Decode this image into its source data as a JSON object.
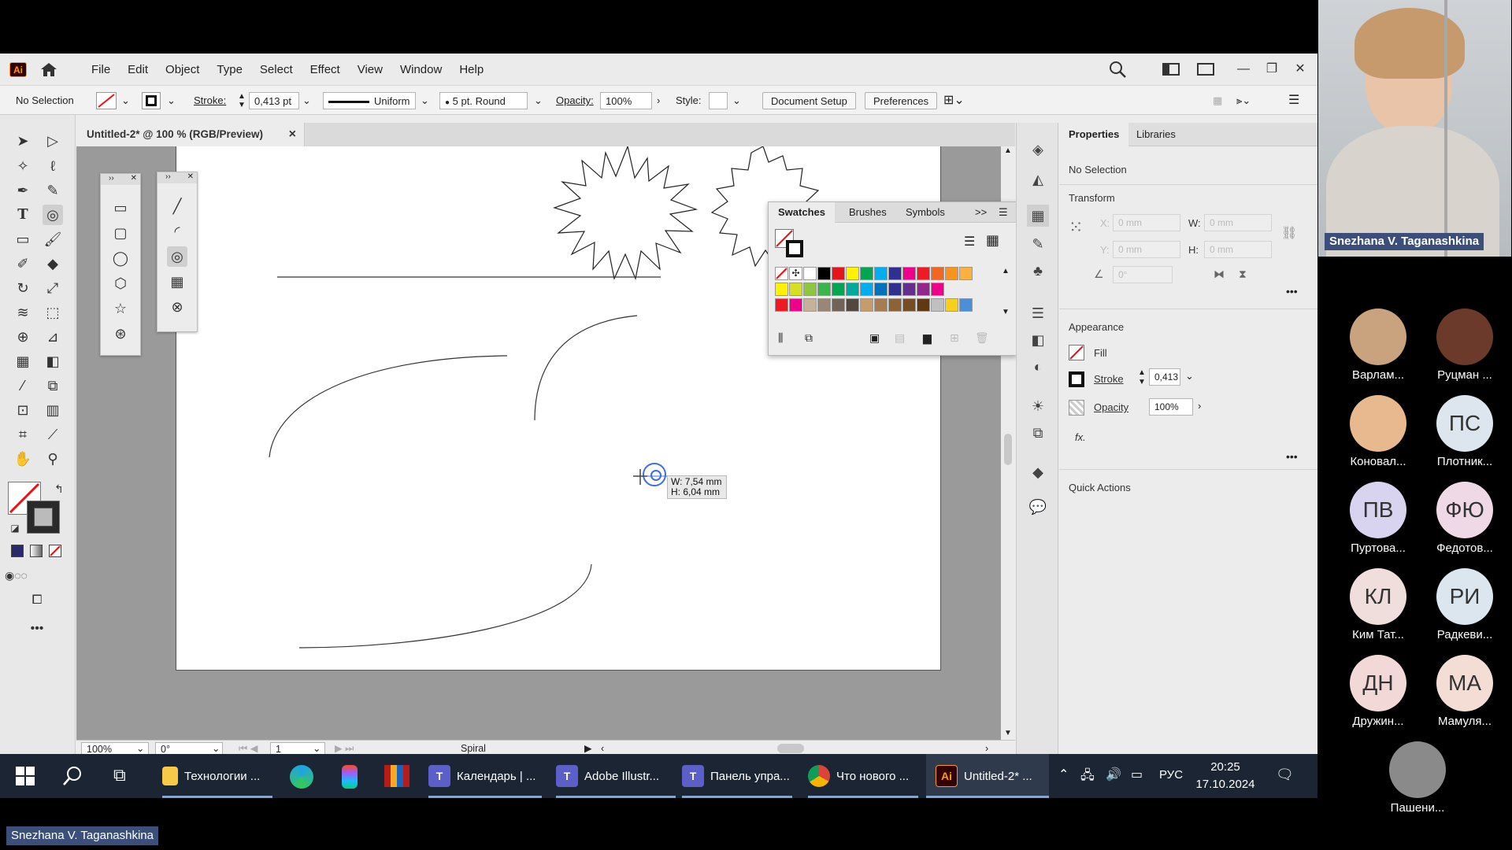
{
  "app": {
    "logo": "Ai",
    "menus": [
      "File",
      "Edit",
      "Object",
      "Type",
      "Select",
      "Effect",
      "View",
      "Window",
      "Help"
    ]
  },
  "control_bar": {
    "selection_label": "No Selection",
    "stroke_label": "Stroke:",
    "stroke_value": "0,413 pt",
    "profile_label": "Uniform",
    "brush_label": "5 pt. Round",
    "opacity_label": "Opacity:",
    "opacity_value": "100%",
    "style_label": "Style:",
    "document_setup": "Document Setup",
    "preferences": "Preferences"
  },
  "document_tab": {
    "title": "Untitled-2* @ 100 % (RGB/Preview)",
    "close": "×"
  },
  "tooltip": {
    "w": "W: 7,54 mm",
    "h": "H: 6,04 mm"
  },
  "swatches_panel": {
    "tabs": [
      "Swatches",
      "Brushes",
      "Symbols"
    ],
    "more": ">>"
  },
  "swatch_colors": [
    [
      "none",
      "reg",
      "#ffffff",
      "#000000",
      "#e8141b",
      "#fff200",
      "#00a651",
      "#00aeef",
      "#2e3192",
      "#ec008c",
      "#ed1c24",
      "#f26522",
      "#f7941d",
      "#fbb040"
    ],
    [
      "#fff200",
      "#d7df23",
      "#8dc63f",
      "#39b54a",
      "#00a651",
      "#00a99d",
      "#00aeef",
      "#0072bc",
      "#2e3192",
      "#662d91",
      "#92278f",
      "#ec008c"
    ],
    [
      "#ed1c24",
      "#ec008c",
      "#c7b299",
      "#998675",
      "#736357",
      "#534741",
      "#c69c6d",
      "#a67c52",
      "#8c6239",
      "#754c24",
      "#603913",
      "#c0c0c0",
      "#f7d117",
      "#4a90d9"
    ]
  ],
  "properties": {
    "tabs": [
      "Properties",
      "Libraries"
    ],
    "selection": "No Selection",
    "transform_label": "Transform",
    "x_label": "X:",
    "y_label": "Y:",
    "w_label": "W:",
    "h_label": "H:",
    "x_value": "0 mm",
    "y_value": "0 mm",
    "w_value": "0 mm",
    "h_value": "0 mm",
    "angle_value": "0°",
    "appearance_label": "Appearance",
    "fill_label": "Fill",
    "stroke_label": "Stroke",
    "stroke_value": "0,413",
    "opacity_label": "Opacity",
    "opacity_value": "100%",
    "fx": "fx.",
    "quick_actions": "Quick Actions"
  },
  "statusbar": {
    "zoom": "100%",
    "rotation": "0°",
    "artboard": "1",
    "tool": "Spiral"
  },
  "taskbar": {
    "items": [
      "Технологии ...",
      "Календарь | ...",
      "Adobe Illustr...",
      "Панель упра...",
      "Что нового ...",
      "Untitled-2* ..."
    ],
    "lang": "РУС",
    "time": "20:25",
    "date": "17.10.2024"
  },
  "video": {
    "presenter": "Snezhana V. Taganashkina",
    "bottom_label": "Snezhana V. Taganashkina",
    "participants": [
      {
        "initials": "",
        "name": "Варлам...",
        "color": "#c9a27e"
      },
      {
        "initials": "",
        "name": "Руцман ...",
        "color": "#6b3a2a"
      },
      {
        "initials": "",
        "name": "Коновал...",
        "color": "#e8b98f"
      },
      {
        "initials": "ПС",
        "name": "Плотник...",
        "color": "#dde6ee"
      },
      {
        "initials": "ПВ",
        "name": "Пуртова...",
        "color": "#d8d3ef"
      },
      {
        "initials": "ФЮ",
        "name": "Федотов...",
        "color": "#f0d9e6"
      },
      {
        "initials": "КЛ",
        "name": "Ким Тат...",
        "color": "#f0dedc"
      },
      {
        "initials": "РИ",
        "name": "Радкеви...",
        "color": "#dbe6ef"
      },
      {
        "initials": "ДН",
        "name": "Дружин...",
        "color": "#f3d8d8"
      },
      {
        "initials": "МА",
        "name": "Мамуля...",
        "color": "#f3ddd5"
      },
      {
        "initials": "",
        "name": "Пашени...",
        "color": "#8a8a8a"
      }
    ]
  }
}
